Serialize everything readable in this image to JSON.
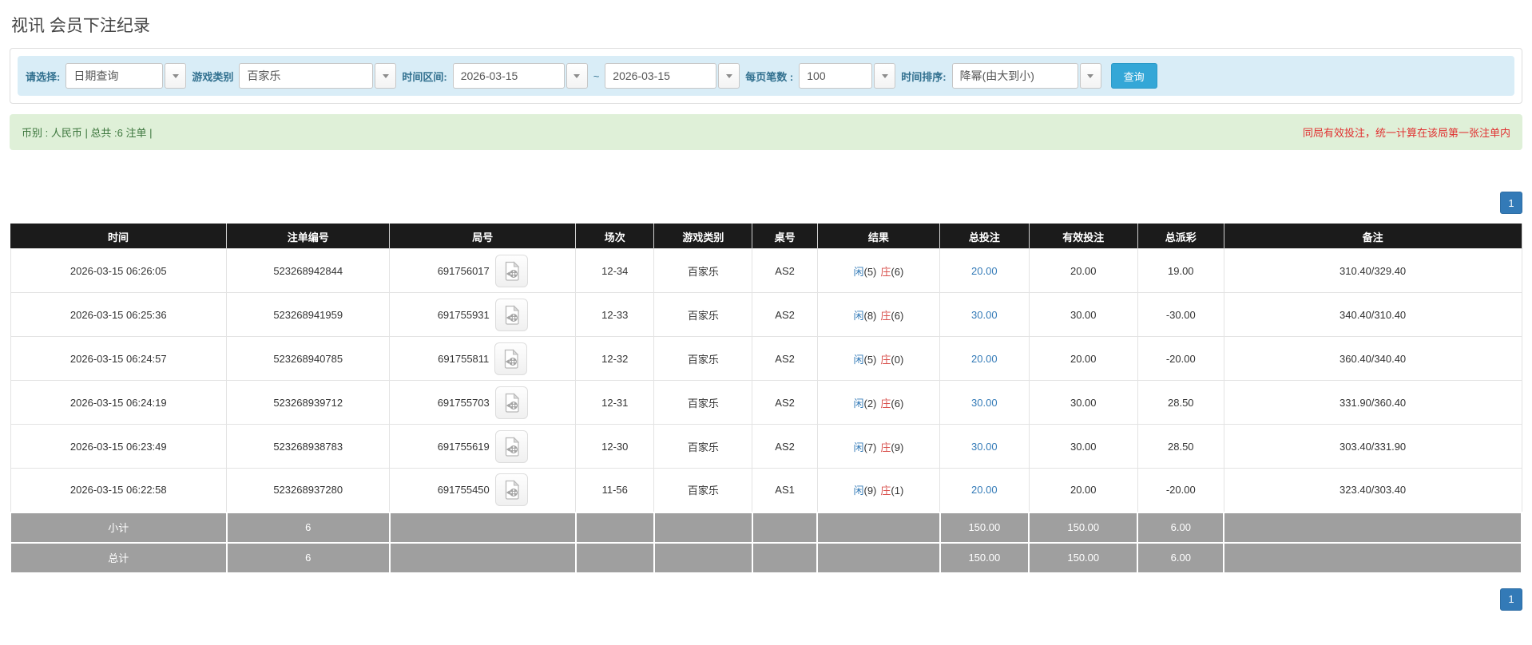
{
  "page": {
    "title": "视讯 会员下注纪录"
  },
  "filters": {
    "select_label": "请选择:",
    "select_value": "日期查询",
    "game_type_label": "游戏类别",
    "game_type_value": "百家乐",
    "time_range_label": "时间区间:",
    "time_from": "2026-03-15",
    "range_separator": "~",
    "time_to": "2026-03-15",
    "page_size_label": "每页笔数 :",
    "page_size_value": "100",
    "sort_label": "时间排序:",
    "sort_value": "降幂(由大到小)",
    "search_button": "查询"
  },
  "summary": {
    "left_text": "币别 : 人民币 | 总共 :6 注单 |",
    "right_note": "同局有效投注，统一计算在该局第一张注单内"
  },
  "pagination": {
    "page": "1"
  },
  "table": {
    "columns": [
      "时间",
      "注单编号",
      "局号",
      "场次",
      "游戏类别",
      "桌号",
      "结果",
      "总投注",
      "有效投注",
      "总派彩",
      "备注"
    ],
    "rows": [
      {
        "time": "2026-03-15 06:26:05",
        "bet_no": "523268942844",
        "round_no": "691756017",
        "session": "12-34",
        "game": "百家乐",
        "table_no": "AS2",
        "result": {
          "player": "闲(5)",
          "banker": "庄(6)"
        },
        "total_bet": "20.00",
        "valid_bet": "20.00",
        "payout": "19.00",
        "note": "310.40/329.40"
      },
      {
        "time": "2026-03-15 06:25:36",
        "bet_no": "523268941959",
        "round_no": "691755931",
        "session": "12-33",
        "game": "百家乐",
        "table_no": "AS2",
        "result": {
          "player": "闲(8)",
          "banker": "庄(6)"
        },
        "total_bet": "30.00",
        "valid_bet": "30.00",
        "payout": "-30.00",
        "note": "340.40/310.40"
      },
      {
        "time": "2026-03-15 06:24:57",
        "bet_no": "523268940785",
        "round_no": "691755811",
        "session": "12-32",
        "game": "百家乐",
        "table_no": "AS2",
        "result": {
          "player": "闲(5)",
          "banker": "庄(0)"
        },
        "total_bet": "20.00",
        "valid_bet": "20.00",
        "payout": "-20.00",
        "note": "360.40/340.40"
      },
      {
        "time": "2026-03-15 06:24:19",
        "bet_no": "523268939712",
        "round_no": "691755703",
        "session": "12-31",
        "game": "百家乐",
        "table_no": "AS2",
        "result": {
          "player": "闲(2)",
          "banker": "庄(6)"
        },
        "total_bet": "30.00",
        "valid_bet": "30.00",
        "payout": "28.50",
        "note": "331.90/360.40"
      },
      {
        "time": "2026-03-15 06:23:49",
        "bet_no": "523268938783",
        "round_no": "691755619",
        "session": "12-30",
        "game": "百家乐",
        "table_no": "AS2",
        "result": {
          "player": "闲(7)",
          "banker": "庄(9)"
        },
        "total_bet": "30.00",
        "valid_bet": "30.00",
        "payout": "28.50",
        "note": "303.40/331.90"
      },
      {
        "time": "2026-03-15 06:22:58",
        "bet_no": "523268937280",
        "round_no": "691755450",
        "session": "11-56",
        "game": "百家乐",
        "table_no": "AS1",
        "result": {
          "player": "闲(9)",
          "banker": "庄(1)"
        },
        "total_bet": "20.00",
        "valid_bet": "20.00",
        "payout": "-20.00",
        "note": "323.40/303.40"
      }
    ],
    "subtotal": {
      "label": "小计",
      "count": "6",
      "total_bet": "150.00",
      "valid_bet": "150.00",
      "payout": "6.00"
    },
    "total": {
      "label": "总计",
      "count": "6",
      "total_bet": "150.00",
      "valid_bet": "150.00",
      "payout": "6.00"
    }
  },
  "colors": {
    "filter_bar_bg": "#d9edf7",
    "filter_label": "#31708f",
    "search_button_bg": "#34a7d7",
    "summary_bg": "#dff0d8",
    "summary_text": "#3c763d",
    "note_red": "#e03131",
    "pagination_blue": "#337ab7",
    "header_bg": "#1b1b1b",
    "footer_bg": "#9f9f9f",
    "player_blue": "#337ab7",
    "banker_red": "#d9534f",
    "bet_link_blue": "#337ab7",
    "negative_red": "#e03131"
  }
}
